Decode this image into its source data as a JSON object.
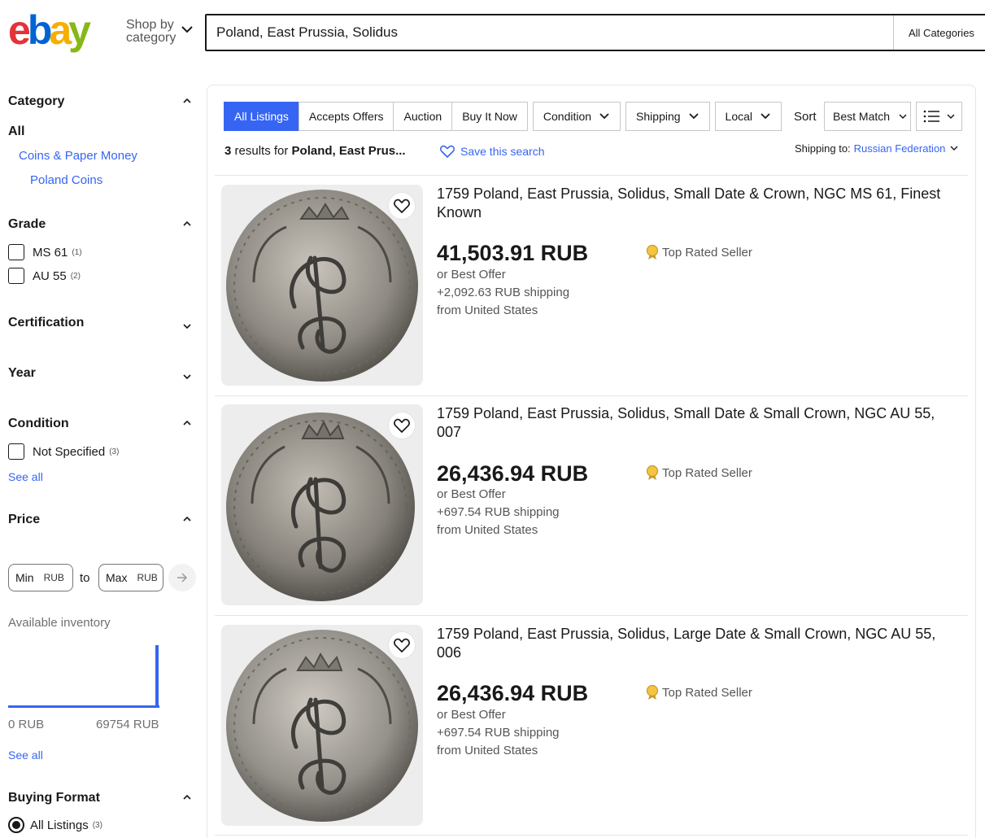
{
  "header": {
    "shop_by": "Shop by",
    "category": "category",
    "search_value": "Poland, East Prussia, Solidus",
    "all_categories": "All Categories",
    "logo_colors": [
      "#e53238",
      "#0064d2",
      "#f5af02",
      "#86b817"
    ]
  },
  "sidebar": {
    "category": {
      "title": "Category",
      "all": "All",
      "items": [
        "Coins & Paper Money",
        "Poland Coins"
      ]
    },
    "grade": {
      "title": "Grade",
      "options": [
        {
          "label": "MS 61",
          "count": "(1)"
        },
        {
          "label": "AU 55",
          "count": "(2)"
        }
      ]
    },
    "certification": {
      "title": "Certification"
    },
    "year": {
      "title": "Year"
    },
    "condition": {
      "title": "Condition",
      "options": [
        {
          "label": "Not Specified",
          "count": "(3)"
        }
      ],
      "see_all": "See all"
    },
    "price": {
      "title": "Price",
      "min_label": "Min",
      "max_label": "Max",
      "unit": "RUB",
      "to": "to",
      "inventory_label": "Available inventory",
      "range_min": "0 RUB",
      "range_max": "69754 RUB",
      "see_all": "See all"
    },
    "buying_format": {
      "title": "Buying Format",
      "options": [
        {
          "label": "All Listings",
          "count": "(3)",
          "selected": true
        }
      ]
    }
  },
  "toolbar": {
    "tabs": [
      "All Listings",
      "Accepts Offers",
      "Auction",
      "Buy It Now"
    ],
    "dropdowns": [
      "Condition",
      "Shipping",
      "Local"
    ],
    "sort_label": "Sort",
    "sort_value": "Best Match",
    "results_count": "3",
    "results_text": "results for",
    "results_query": "Poland, East Prus...",
    "save_search": "Save this search",
    "shipping_to_label": "Shipping to:",
    "shipping_to_value": "Russian Federation",
    "accent": "#3665f3"
  },
  "items": [
    {
      "title": "1759 Poland, East Prussia, Solidus, Small Date & Crown, NGC MS 61, Finest Known",
      "price": "41,503.91 RUB",
      "offer": "or Best Offer",
      "shipping": "+2,092.63 RUB shipping",
      "from": "from United States",
      "badge": "Top Rated Seller"
    },
    {
      "title": "1759 Poland, East Prussia, Solidus, Small Date & Small Crown, NGC AU 55, 007",
      "price": "26,436.94 RUB",
      "offer": "or Best Offer",
      "shipping": "+697.54 RUB shipping",
      "from": "from United States",
      "badge": "Top Rated Seller"
    },
    {
      "title": "1759 Poland, East Prussia, Solidus, Large Date & Small Crown, NGC AU 55, 006",
      "price": "26,436.94 RUB",
      "offer": "or Best Offer",
      "shipping": "+697.54 RUB shipping",
      "from": "from United States",
      "badge": "Top Rated Seller"
    }
  ]
}
